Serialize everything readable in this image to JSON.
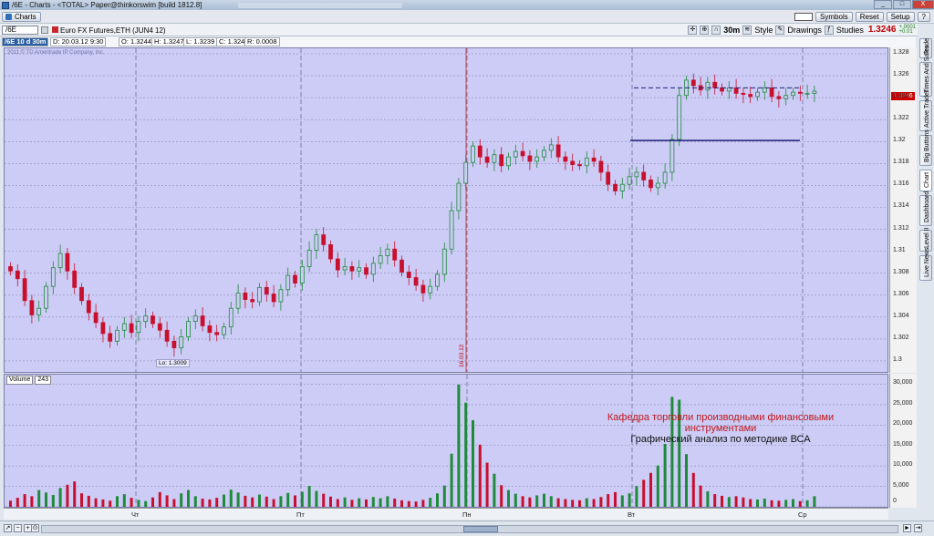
{
  "window": {
    "title": "/6E - Charts - <TOTAL> Paper@thinkorswim [build 1812.8]",
    "min_label": "_",
    "max_label": "□",
    "close_label": "X"
  },
  "menu": {
    "charts_tab": "Charts",
    "symbols_label": "Symbols",
    "reset_label": "Reset",
    "setup_label": "Setup"
  },
  "toolbar": {
    "symbol": "/6E",
    "product_name": "Euro FX Futures,ETH (JUN4 12)",
    "timeframe": "30m",
    "style_label": "Style",
    "drawings_label": "Drawings",
    "studies_label": "Studies",
    "last_price": "1.3246",
    "change_up": "+.0001",
    "change_pct": "+0.01"
  },
  "info": {
    "timeframe": "/6E 10 d 30m",
    "date": "D: 20.03.12 9:30",
    "open": "O: 1.3244",
    "high": "H: 1.3247",
    "low": "L: 1.3239",
    "close": "C: 1.324",
    "range": "R: 0.0008"
  },
  "chart_meta": {
    "copyright": "2011 © TD Ameritrade IP Company, Inc.",
    "low_label": "Lo: 1.3009",
    "date_marker": "16.03.12",
    "volume_label": "Volume",
    "volume_value": "243",
    "price_tag": "1.3246"
  },
  "overlay": {
    "line1": "Кафедра торговли производными финансовыми",
    "line2": "инструментами",
    "line3": "Графический анализ по методике ВСА"
  },
  "side_tabs": [
    "Trade",
    "Times And Sales",
    "Active Trader",
    "Big Buttons",
    "Chart",
    "Dashboard",
    "Level II",
    "Live News"
  ],
  "colors": {
    "chart_bg": "#ccccf6",
    "up": "#1f8a3a",
    "down": "#c8102e",
    "hline": "#20207a",
    "accent": "#c62828"
  },
  "chart_data": [
    {
      "type": "candlestick",
      "title": "/6E 30m",
      "ylim": [
        1.299,
        1.3285
      ],
      "yticks": [
        "1.328",
        "1.326",
        "1.324",
        "1.322",
        "1.32",
        "1.318",
        "1.316",
        "1.314",
        "1.312",
        "1.31",
        "1.308",
        "1.306",
        "1.304",
        "1.302",
        "1.3"
      ],
      "ytick_values": [
        1.328,
        1.326,
        1.324,
        1.322,
        1.32,
        1.318,
        1.316,
        1.314,
        1.312,
        1.31,
        1.308,
        1.306,
        1.304,
        1.302,
        1.3
      ],
      "xticks": [
        "Чт",
        "Пт",
        "Пн",
        "Вт",
        "Ср"
      ],
      "close": [
        1.3082,
        1.3075,
        1.3055,
        1.3042,
        1.3048,
        1.3068,
        1.3085,
        1.3098,
        1.3082,
        1.3067,
        1.3055,
        1.3044,
        1.3035,
        1.3025,
        1.3018,
        1.3028,
        1.3034,
        1.3026,
        1.3036,
        1.3041,
        1.3034,
        1.3028,
        1.3018,
        1.3012,
        1.3022,
        1.3036,
        1.3041,
        1.3032,
        1.3026,
        1.3024,
        1.3031,
        1.3048,
        1.3062,
        1.3056,
        1.3054,
        1.3067,
        1.3061,
        1.3054,
        1.3065,
        1.3078,
        1.3071,
        1.3086,
        1.3101,
        1.3115,
        1.3106,
        1.3093,
        1.3083,
        1.3086,
        1.3082,
        1.3085,
        1.3079,
        1.3089,
        1.3096,
        1.3102,
        1.3092,
        1.3081,
        1.3076,
        1.3069,
        1.3062,
        1.3068,
        1.3079,
        1.3102,
        1.3137,
        1.3162,
        1.3181,
        1.3196,
        1.3186,
        1.3181,
        1.3188,
        1.3178,
        1.3186,
        1.3191,
        1.3187,
        1.3182,
        1.3186,
        1.3192,
        1.3197,
        1.3186,
        1.3182,
        1.3179,
        1.3178,
        1.3185,
        1.3182,
        1.3172,
        1.3161,
        1.3155,
        1.3161,
        1.3168,
        1.3172,
        1.3165,
        1.3158,
        1.3162,
        1.3172,
        1.3202,
        1.3242,
        1.3256,
        1.3251,
        1.3247,
        1.3254,
        1.3249,
        1.3246,
        1.3249,
        1.3244,
        1.3243,
        1.3241,
        1.3245,
        1.3249,
        1.3241,
        1.3239,
        1.3242,
        1.3245,
        1.3244,
        1.3244,
        1.3246
      ],
      "high_line": 1.3249,
      "low_line": 1.3201,
      "low_marker": 1.3009
    },
    {
      "type": "bar",
      "title": "Volume",
      "ylim": [
        0,
        31000
      ],
      "yticks": [
        "30,000",
        "25,000",
        "20,000",
        "15,000",
        "10,000",
        "5,000",
        "0"
      ],
      "ytick_values": [
        30000,
        25000,
        20000,
        15000,
        10000,
        5000,
        0
      ],
      "values": [
        1500,
        2200,
        3100,
        2600,
        4100,
        3500,
        2900,
        4600,
        5400,
        6200,
        3300,
        2700,
        2100,
        1800,
        1500,
        2600,
        3100,
        2200,
        1700,
        1400,
        2300,
        3600,
        2800,
        1900,
        3300,
        4100,
        2600,
        2000,
        1800,
        2200,
        3000,
        4200,
        3500,
        2700,
        2300,
        3000,
        2500,
        1900,
        2600,
        3400,
        2800,
        3700,
        5100,
        3900,
        3200,
        2500,
        1900,
        2300,
        1700,
        2100,
        1800,
        2400,
        2100,
        2600,
        2000,
        1600,
        1400,
        1300,
        1700,
        2200,
        3300,
        5200,
        13000,
        29900,
        25500,
        21200,
        15200,
        10800,
        8100,
        5300,
        4100,
        3200,
        2600,
        2300,
        2800,
        3200,
        2600,
        2100,
        1900,
        1700,
        1600,
        2100,
        1900,
        2400,
        3100,
        3600,
        2800,
        3300,
        5100,
        6600,
        8300,
        10100,
        15400,
        26900,
        26200,
        12900,
        8300,
        5200,
        3800,
        3100,
        2700,
        2400,
        2600,
        2300,
        1900,
        1800,
        2000,
        1600,
        1500,
        1700,
        1900,
        1400,
        1600,
        2600
      ]
    }
  ]
}
